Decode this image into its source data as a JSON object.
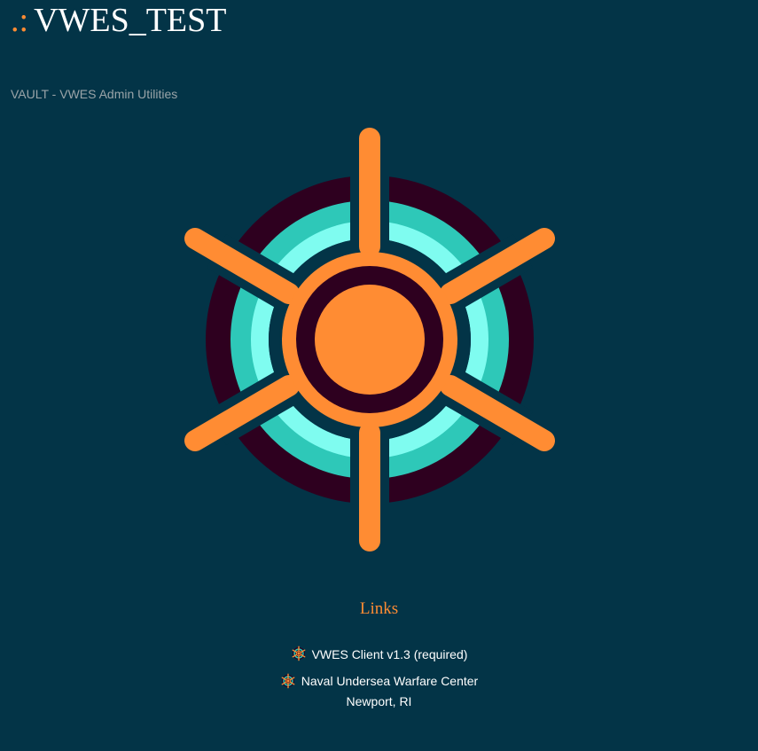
{
  "header": {
    "prefix": ".:",
    "title": "VWES_TEST"
  },
  "subtitle": "VAULT - VWES Admin Utilities",
  "logo": {
    "icon": "helm-wheel-logo-icon",
    "colors": {
      "orange": "#ff8c33",
      "dark_ring": "#2e001f",
      "teal": "#2ec8b8",
      "light_teal": "#7ffcf0",
      "background": "#033447"
    }
  },
  "links": {
    "heading": "Links",
    "items": [
      {
        "label": "VWES Client v1.3 (required)",
        "icon": "helm-wheel-mini-icon"
      },
      {
        "label": "Naval Undersea Warfare Center",
        "label_line2": "Newport, RI",
        "icon": "helm-wheel-mini-icon"
      }
    ]
  }
}
